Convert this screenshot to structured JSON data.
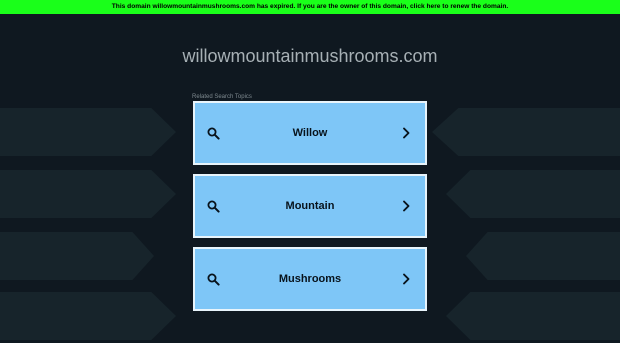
{
  "banner": {
    "text": "This domain willowmountainmushrooms.com has expired. If you are the owner of this domain, click here to renew the domain."
  },
  "header": {
    "domain": "willowmountainmushrooms.com"
  },
  "related": {
    "label": "Related Search Topics",
    "topics": [
      {
        "label": "Willow"
      },
      {
        "label": "Mountain"
      },
      {
        "label": "Mushrooms"
      }
    ]
  },
  "icons": {
    "search": "search-icon",
    "chevron": "chevron-right-icon"
  },
  "colors": {
    "background": "#0f1820",
    "banner": "#1aff1a",
    "card": "#7ec6f7",
    "card_border": "#e8f4fb",
    "title_text": "#a7b0b5"
  }
}
